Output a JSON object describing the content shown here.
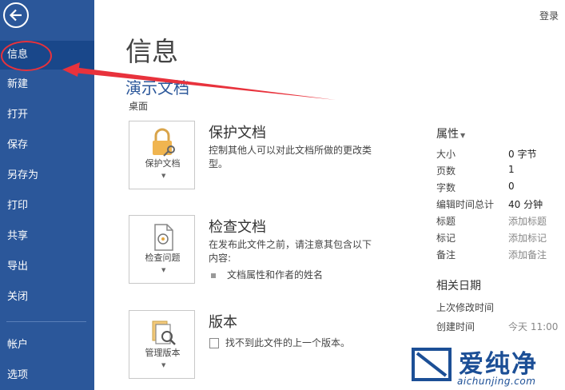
{
  "sidebar": {
    "items": [
      {
        "label": "信息",
        "active": true
      },
      {
        "label": "新建"
      },
      {
        "label": "打开"
      },
      {
        "label": "保存"
      },
      {
        "label": "另存为"
      },
      {
        "label": "打印"
      },
      {
        "label": "共享"
      },
      {
        "label": "导出"
      },
      {
        "label": "关闭"
      },
      {
        "label": "帐户"
      },
      {
        "label": "选项"
      }
    ]
  },
  "header": {
    "login": "登录",
    "page_title": "信息",
    "doc_title": "演示文档",
    "doc_location": "桌面"
  },
  "protect": {
    "button_label": "保护文档",
    "heading": "保护文档",
    "description": "控制其他人可以对此文档所做的更改类型。"
  },
  "inspect": {
    "button_label": "检查问题",
    "heading": "检查文档",
    "description": "在发布此文件之前，请注意其包含以下内容:",
    "bullet": "文档属性和作者的姓名"
  },
  "versions": {
    "button_label": "管理版本",
    "heading": "版本",
    "message": "找不到此文件的上一个版本。"
  },
  "properties": {
    "heading": "属性",
    "rows": [
      {
        "label": "大小",
        "value": "0 字节"
      },
      {
        "label": "页数",
        "value": "1"
      },
      {
        "label": "字数",
        "value": "0"
      },
      {
        "label": "编辑时间总计",
        "value": "40 分钟"
      },
      {
        "label": "标题",
        "value": "添加标题"
      },
      {
        "label": "标记",
        "value": "添加标记"
      },
      {
        "label": "备注",
        "value": "添加备注"
      }
    ]
  },
  "related_dates": {
    "heading": "相关日期",
    "rows": [
      {
        "label": "上次修改时间",
        "value": ""
      },
      {
        "label": "创建时间",
        "value": "今天 11:00"
      }
    ]
  },
  "watermark": {
    "text": "爱纯净",
    "url": "aichunjing.com"
  },
  "colors": {
    "sidebar": "#2b579a",
    "sidebar_active": "#19478a",
    "annotation_red": "#e8323c"
  }
}
